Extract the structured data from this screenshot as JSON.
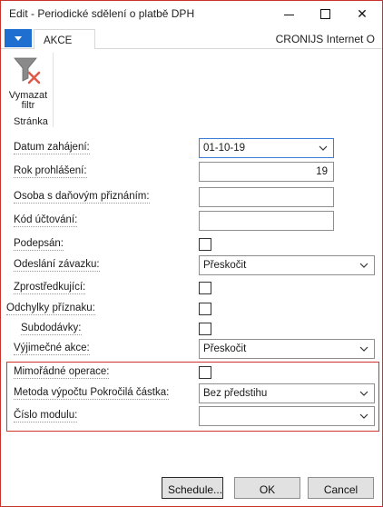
{
  "window": {
    "title": "Edit - Periodické sdělení o platbě DPH",
    "minimize_glyph": "",
    "close_glyph": "✕"
  },
  "ribbon": {
    "tab_label": "AKCE",
    "company": "CRONIJS Internet O",
    "clear_filter_line1": "Vymazat",
    "clear_filter_line2": "filtr",
    "group_label": "Stránka"
  },
  "form": {
    "fields": [
      {
        "label": "Datum zahájení:",
        "type": "date",
        "value": "01-10-19"
      },
      {
        "label": "Rok prohlášení:",
        "type": "text",
        "value": "19"
      },
      {
        "label": "Osoba s daňovým přiznáním:",
        "type": "text",
        "value": ""
      },
      {
        "label": "Kód účtování:",
        "type": "text",
        "value": ""
      },
      {
        "label": "Podepsán:",
        "type": "checkbox",
        "checked": false
      },
      {
        "label": "Odeslání závazku:",
        "type": "select",
        "value": "Přeskočit"
      },
      {
        "label": "Zprostředkující:",
        "type": "checkbox",
        "checked": false
      },
      {
        "label": "Odchylky příznaku:",
        "type": "checkbox",
        "checked": false
      },
      {
        "label": "Subdodávky:",
        "type": "checkbox",
        "checked": false
      },
      {
        "label": "Výjimečné akce:",
        "type": "select",
        "value": "Přeskočit"
      },
      {
        "label": "Mimořádné operace:",
        "type": "checkbox",
        "checked": false
      },
      {
        "label": "Metoda výpočtu Pokročilá částka:",
        "type": "select",
        "value": "Bez předstihu"
      },
      {
        "label": "Číslo modulu:",
        "type": "select",
        "value": ""
      }
    ]
  },
  "buttons": {
    "schedule": "Schedule...",
    "ok": "OK",
    "cancel": "Cancel"
  },
  "colors": {
    "accent": "#1e6fd0",
    "highlight_border": "#d0342c",
    "window_border": "#c8332b"
  },
  "icons": {
    "clear_filter": "filter-clear-icon",
    "dropdown": "chevron-down-icon"
  }
}
